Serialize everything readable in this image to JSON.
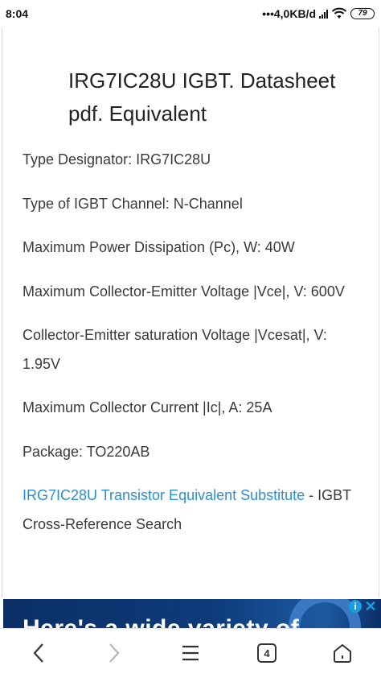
{
  "status_bar": {
    "time": "8:04",
    "network_speed": "•••4,0KB/d",
    "battery": "79"
  },
  "page": {
    "title": "IRG7IC28U IGBT. Datasheet pdf. Equivalent",
    "specs": [
      "Type Designator: IRG7IC28U",
      "Type of IGBT Channel: N-Channel",
      "Maximum Power Dissipation (Pc), W: 40W",
      "Maximum Collector-Emitter Voltage |Vce|, V: 600V",
      "Collector-Emitter saturation Voltage |Vcesat|, V: 1.95V",
      "Maximum Collector Current |Ic|, A: 25A",
      "Package: TO220AB"
    ],
    "equivalent_link_text": "IRG7IC28U Transistor Equivalent Substitute",
    "equivalent_suffix": " - IGBT Cross-Reference Search"
  },
  "ad": {
    "text": "Here's a wide variety of",
    "info_icon": "info-icon",
    "close_icon": "close-icon"
  },
  "nav": {
    "tab_count": "4",
    "icons": [
      "back-arrow-icon",
      "forward-arrow-icon",
      "menu-icon",
      "tabs-icon",
      "home-icon"
    ]
  },
  "colors": {
    "link": "#2c8fd1",
    "text": "#3a3a3a",
    "ad_background": "#0d3b7a",
    "ad_info": "#1a9de0"
  }
}
